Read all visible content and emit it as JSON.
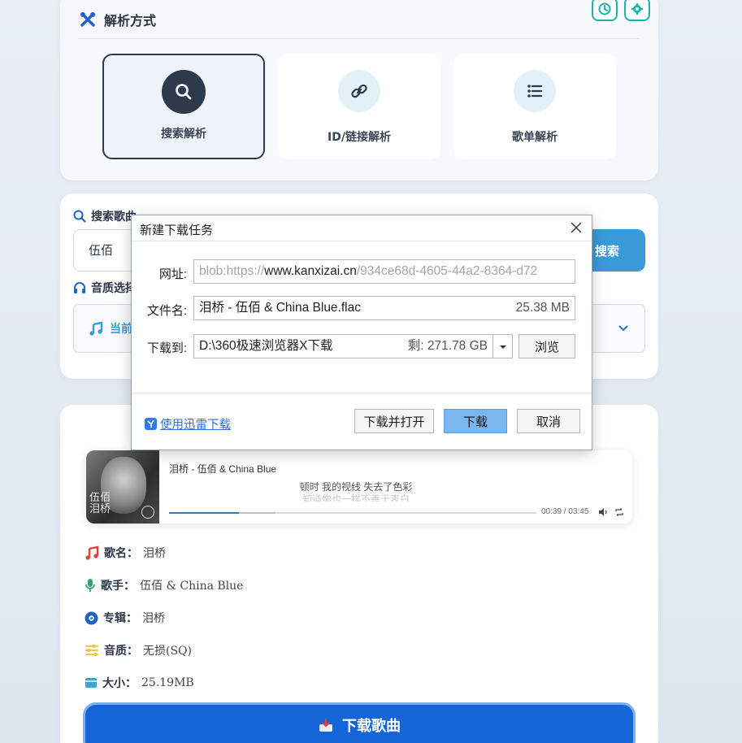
{
  "method": {
    "title": "解析方式",
    "options": [
      {
        "label": "搜索解析",
        "icon": "search-icon",
        "active": true
      },
      {
        "label": "ID/链接解析",
        "icon": "link-icon",
        "active": false
      },
      {
        "label": "歌单解析",
        "icon": "list-icon",
        "active": false
      }
    ],
    "history_icon": "history-icon",
    "settings_icon": "gear-icon"
  },
  "search": {
    "label": "搜索歌曲",
    "query": "伍佰",
    "button": "搜索",
    "quality_label": "音质选择",
    "quality_value": "当前"
  },
  "player": {
    "title": "泪桥 - 伍佰 & China Blue",
    "lyric_current": "顿时 我的视线 失去了色彩",
    "lyric_next": "知道你也一样不善于表白",
    "time": "00:39 / 03:45",
    "progress": 0.19,
    "buffered": 0.29,
    "cover_text": "伍佰\n泪桥"
  },
  "song": {
    "name_label": "歌名：",
    "name": "泪桥",
    "artist_label": "歌手：",
    "artist": "伍佰 & China Blue",
    "album_label": "专辑：",
    "album": "泪桥",
    "quality_label": "音质：",
    "quality": "无损(SQ)",
    "size_label": "大小：",
    "size": "25.19MB",
    "download_button": "下载歌曲"
  },
  "dialog": {
    "title": "新建下载任务",
    "url_label": "网址:",
    "url_prefix": "blob:https://",
    "url_host": "www.kanxizai.cn",
    "url_rest": "/934ce68d-4605-44a2-8364-d72",
    "filename_label": "文件名:",
    "filename": "泪桥 - 伍佰 & China Blue.flac",
    "file_size": "25.38 MB",
    "saveto_label": "下载到:",
    "saveto_path": "D:\\360极速浏览器X下载",
    "free_space": "剩: 271.78 GB",
    "browse": "浏览",
    "xunlei_link": "使用迅雷下载",
    "btn_download_open": "下载并打开",
    "btn_download": "下载",
    "btn_cancel": "取消"
  },
  "colors": {
    "accent": "#3a9ad9",
    "teal": "#20b2aa",
    "dark": "#2d3a4b",
    "download_blue": "#1565d8"
  }
}
